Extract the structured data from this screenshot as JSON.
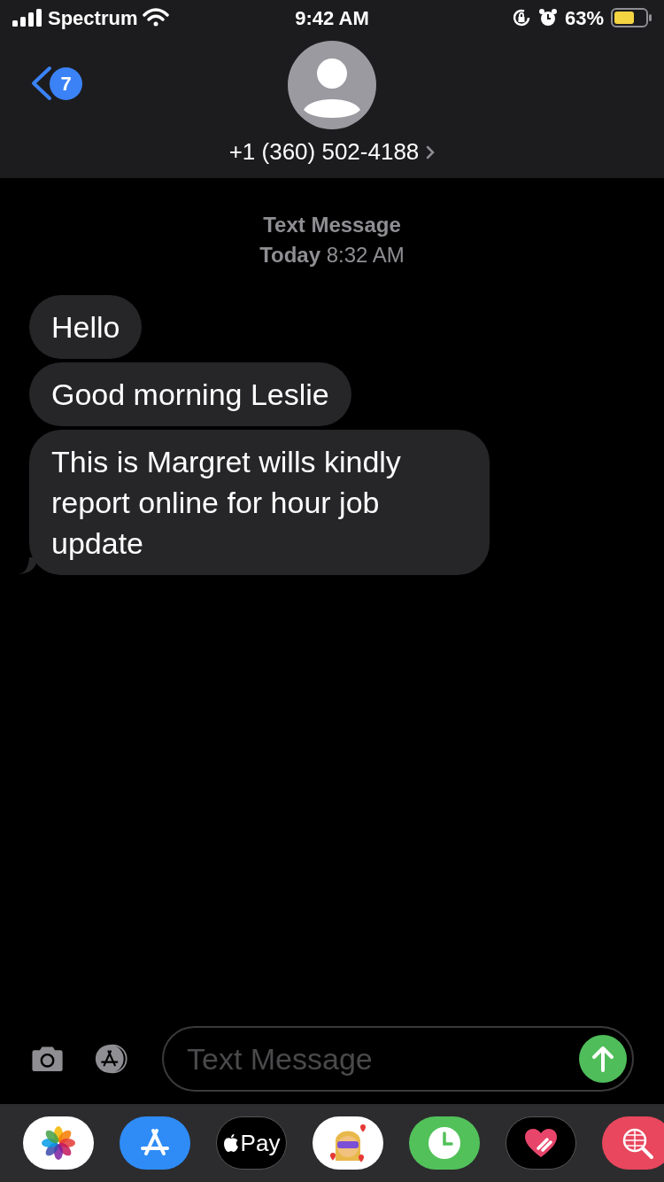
{
  "status_bar": {
    "carrier": "Spectrum",
    "time": "9:42 AM",
    "battery": "63%"
  },
  "header": {
    "back_badge": "7",
    "contact": "+1 (360) 502-4188"
  },
  "thread": {
    "service": "Text Message",
    "timestamp": "**Today** 8:32 AM"
  },
  "messages": [
    {
      "text": "Hello"
    },
    {
      "text": "Good morning Leslie"
    },
    {
      "text": "This is Margret wills kindly report online for hour job update"
    }
  ],
  "composer": {
    "placeholder": "Text Message"
  },
  "app_tray": [
    {
      "kind": "photos"
    },
    {
      "kind": "appstore"
    },
    {
      "kind": "applepay",
      "label": "Pay"
    },
    {
      "kind": "memoji"
    },
    {
      "kind": "clock"
    },
    {
      "kind": "heart"
    },
    {
      "kind": "search"
    }
  ]
}
